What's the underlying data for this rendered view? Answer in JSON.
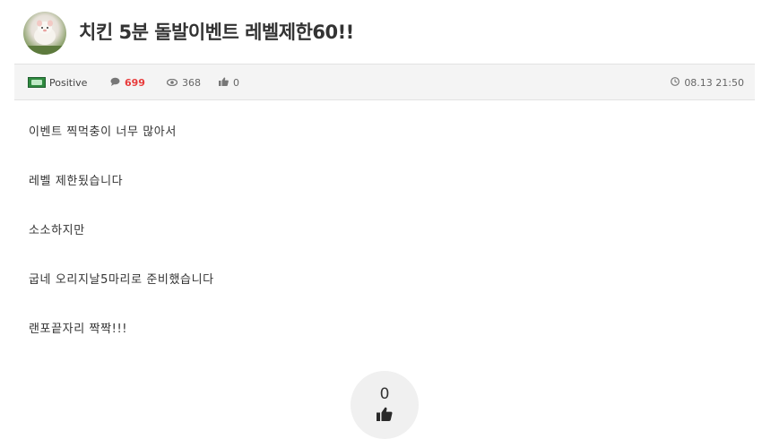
{
  "post": {
    "title": "치킨 5분 돌발이벤트 레벨제한60!!"
  },
  "meta": {
    "author": "Positive",
    "comments": "699",
    "views": "368",
    "likes": "0",
    "datetime": "08.13 21:50"
  },
  "content": {
    "lines": [
      "이벤트 찍먹충이 너무 많아서",
      "레벨 제한됬습니다",
      "소소하지만",
      "굽네 오리지날5마리로 준비했습니다",
      "랜포끝자리 짝짝!!!"
    ]
  },
  "like_button": {
    "count": "0"
  },
  "icons": {
    "comment": "comment-icon",
    "views": "eye-icon",
    "likes": "thumbs-up-icon",
    "time": "clock-icon",
    "level": "level-badge-icon"
  },
  "colors": {
    "comment_count": "#e83b3b",
    "meta_bar_bg": "#f4f4f4",
    "like_circle_bg": "#f0f0f0"
  }
}
